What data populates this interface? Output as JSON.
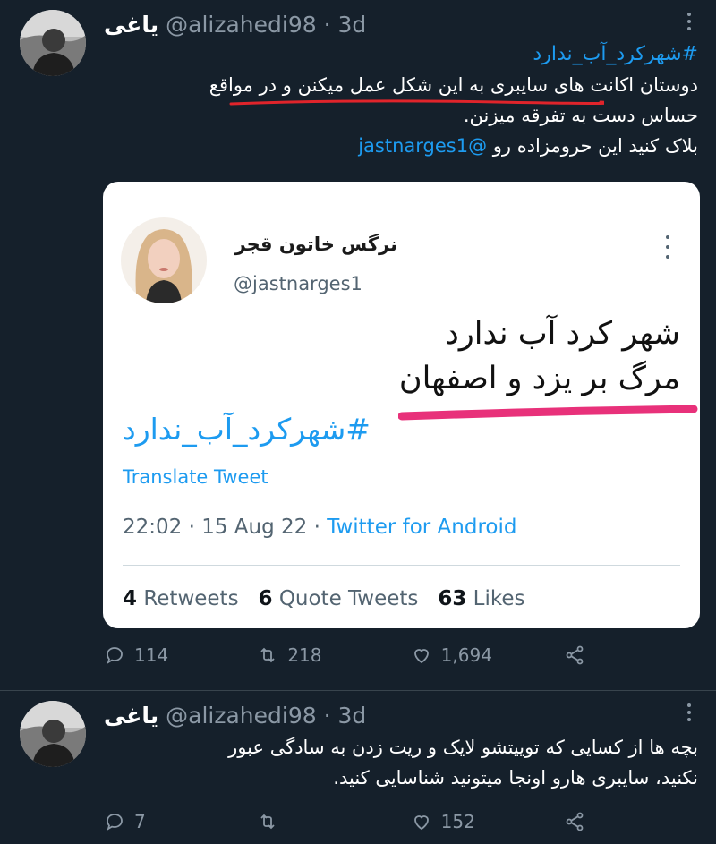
{
  "tweets": [
    {
      "name": "یاغی",
      "handle": "@alizahedi98 · 3d",
      "hashtag": "#شهرکرد_آب_ندارد",
      "line1": "دوستان اکانت های سایبری به این شکل عمل میکنن و در مواقع",
      "line2": "حساس دست به تفرقه میزنن.",
      "line3_text": "بلاک کنید این حرومزاده رو",
      "line3_mention": "@jastnarges1",
      "embed": {
        "name": "نرگس خاتون قجر",
        "handle": "@jastnarges1",
        "line1": "شهر کرد آب ندارد",
        "line2": "مرگ بر یزد و اصفهان",
        "hashtag": "#شهرکرد_آب_ندارد",
        "translate": "Translate Tweet",
        "meta": "22:02 · 15 Aug 22 · ",
        "source": "Twitter for Android",
        "retweets_count": "4",
        "retweets_label": " Retweets",
        "quotes_count": "6",
        "quotes_label": " Quote Tweets",
        "likes_count": "63",
        "likes_label": " Likes"
      },
      "replies": "114",
      "retweets": "218",
      "likes": "1,694"
    },
    {
      "name": "یاغی",
      "handle": "@alizahedi98 · 3d",
      "line1": "بچه ها از کسایی که توییتشو لایک و ریت زدن به سادگی عبور",
      "line2": "نکنید، سایبری هارو اونجا میتونید شناسایی کنید.",
      "replies": "7",
      "retweets": "",
      "likes": "152"
    }
  ],
  "colors": {
    "background": "#15202b",
    "link": "#1d9bf0",
    "underline_red": "#e0242b",
    "underline_pink": "#e8317a"
  },
  "icons": [
    "reply-icon",
    "retweet-icon",
    "like-icon",
    "share-icon",
    "more-icon"
  ]
}
